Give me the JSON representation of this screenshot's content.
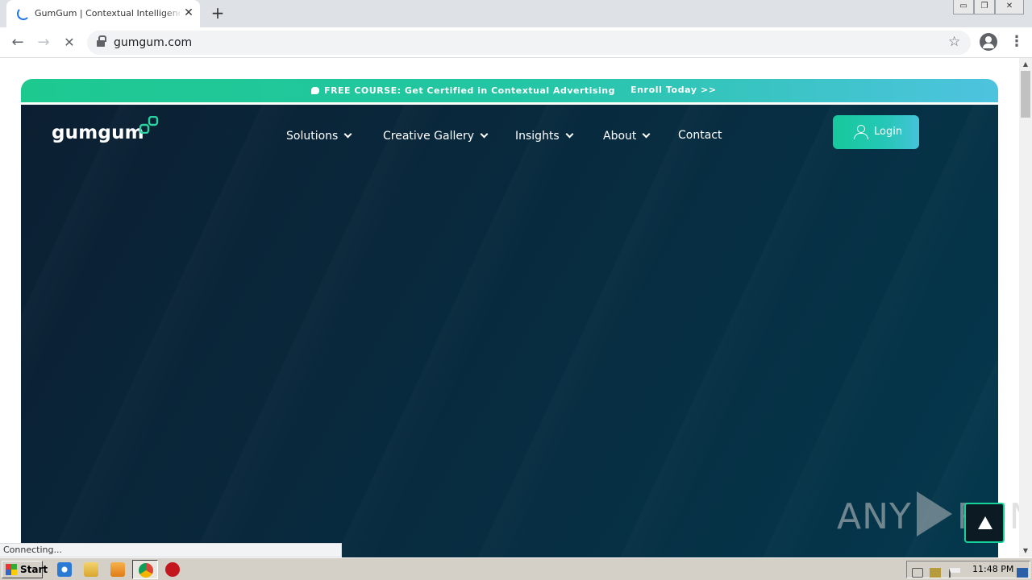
{
  "browser": {
    "tab_title": "GumGum | Contextual Intelligence C",
    "tab_close": "✕",
    "new_tab": "+",
    "url": "gumgum.com",
    "window_controls": [
      "▭",
      "❐",
      "✕"
    ],
    "status_text": "Connecting..."
  },
  "site": {
    "banner_prefix": "FREE COURSE:",
    "banner_text": "Get Certified in Contextual Advertising",
    "banner_link": "Enroll Today >>",
    "logo_text": "gumgum",
    "nav": [
      {
        "label": "Solutions",
        "dropdown": true
      },
      {
        "label": "Creative Gallery",
        "dropdown": true
      },
      {
        "label": "Insights",
        "dropdown": true
      },
      {
        "label": "About",
        "dropdown": true
      },
      {
        "label": "Contact",
        "dropdown": false
      }
    ],
    "login_label": "Login",
    "accent": "#1ec990",
    "hero_bg": "#082b3f"
  },
  "watermark": {
    "left": "ANY",
    "right": "RUN"
  },
  "taskbar": {
    "start_label": "Start",
    "clock": "11:48 PM"
  }
}
